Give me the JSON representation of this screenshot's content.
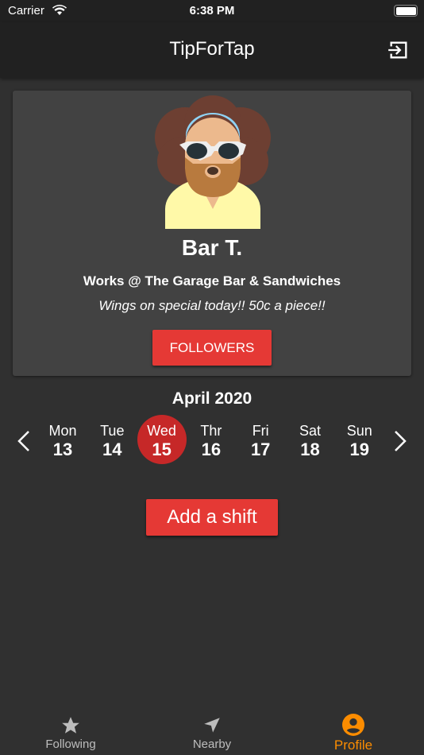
{
  "status": {
    "carrier": "Carrier",
    "time": "6:38 PM"
  },
  "header": {
    "title": "TipForTap",
    "logout_icon": "logout-icon"
  },
  "profile": {
    "name": "Bar T.",
    "works": "Works @ The Garage Bar & Sandwiches",
    "special": "Wings on special today!! 50c a piece!!",
    "followers_label": "FOLLOWERS"
  },
  "calendar": {
    "month": "April 2020",
    "days": [
      {
        "name": "Mon",
        "date": "13"
      },
      {
        "name": "Tue",
        "date": "14"
      },
      {
        "name": "Wed",
        "date": "15",
        "selected": true
      },
      {
        "name": "Thr",
        "date": "16"
      },
      {
        "name": "Fri",
        "date": "17"
      },
      {
        "name": "Sat",
        "date": "18"
      },
      {
        "name": "Sun",
        "date": "19"
      }
    ]
  },
  "add_shift_label": "Add a shift",
  "tabs": [
    {
      "label": "Following",
      "icon": "star-icon"
    },
    {
      "label": "Nearby",
      "icon": "navigation-icon"
    },
    {
      "label": "Profile",
      "icon": "account-icon",
      "active": true
    }
  ],
  "colors": {
    "accent": "#e53935",
    "selected_day": "#c62828",
    "active_tab": "#fb8c00",
    "background": "#303030",
    "card": "#424242"
  }
}
